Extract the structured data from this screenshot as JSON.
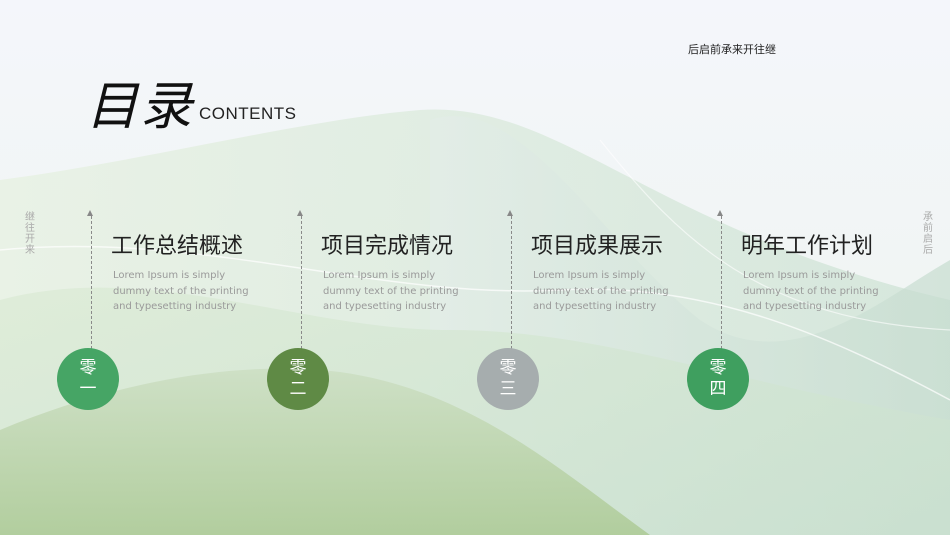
{
  "header": {
    "top_right_text": "后启前承来开往继",
    "title": "目录",
    "subtitle": "CONTENTS"
  },
  "side_left": [
    "继",
    "往",
    "开",
    "来"
  ],
  "side_right": [
    "承",
    "前",
    "启",
    "后"
  ],
  "items": [
    {
      "heading": "工作总结概述",
      "desc": "Lorem Ipsum is simply dummy text of the printing and typesetting industry",
      "num_top": "零",
      "num_bottom": "一",
      "color": "#46a565"
    },
    {
      "heading": "项目完成情况",
      "desc": "Lorem Ipsum is simply dummy text of the printing and typesetting industry",
      "num_top": "零",
      "num_bottom": "二",
      "color": "#5f8a45"
    },
    {
      "heading": "项目成果展示",
      "desc": "Lorem Ipsum is simply dummy text of the printing and typesetting industry",
      "num_top": "零",
      "num_bottom": "三",
      "color": "#a6adae"
    },
    {
      "heading": "明年工作计划",
      "desc": "Lorem Ipsum is simply dummy text of the printing and typesetting industry",
      "num_top": "零",
      "num_bottom": "四",
      "color": "#3f9f5f"
    }
  ]
}
